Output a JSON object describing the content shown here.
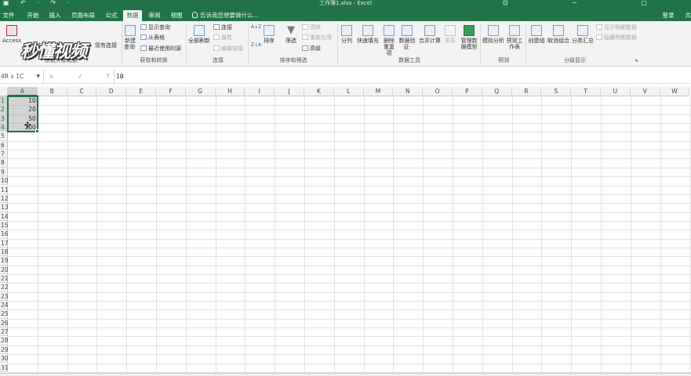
{
  "window": {
    "title": "工作簿1.xlsx - Excel",
    "quick_access": "▣ ↶ · ↷ ·",
    "controls": "⊡ ─ ▢"
  },
  "tabs": [
    "文件",
    "开始",
    "插入",
    "页面布局",
    "公式",
    "数据",
    "审阅",
    "视图"
  ],
  "active_tab": "数据",
  "tellme": "告诉我您想要做什么...",
  "account": {
    "login": "登录",
    "share": "共"
  },
  "ribbon": {
    "external": {
      "access": "Access",
      "web": "自网站",
      "text": "自文本",
      "other": "自其他来源",
      "existing": "现有连接",
      "group": "获取外部数据"
    },
    "transform": {
      "new_query": "新建查询·",
      "show_queries": "显示查询",
      "from_table": "从表格",
      "recent": "最近使用的源",
      "group": "获取和转换"
    },
    "connections": {
      "refresh_all": "全部刷新",
      "connections": "连接",
      "properties": "属性",
      "edit_links": "编辑链接",
      "group": "连接"
    },
    "sort_filter": {
      "sort": "排序",
      "filter": "筛选",
      "clear": "清除",
      "reapply": "重新应用",
      "advanced": "高级",
      "group": "排序和筛选"
    },
    "data_tools": {
      "split": "分列",
      "flash_fill": "快速填充",
      "remove_dup": "删除重复项",
      "validation": "数据验证·",
      "consolidate": "合并计算",
      "relationships": "关系",
      "data_model": "管理数据模型",
      "group": "数据工具"
    },
    "forecast": {
      "whatif": "模拟分析",
      "forecast_sheet": "预测工作表",
      "group": "预测"
    },
    "outline": {
      "group_btn": "创建组",
      "ungroup": "取消组合",
      "subtotal": "分类汇总",
      "show_detail": "显示明细数据",
      "hide_detail": "隐藏明细数据",
      "group": "分级显示"
    }
  },
  "watermark": "秒懂视频",
  "formula_bar": {
    "name_box": "4R x 1C",
    "fx_buttons": "× ✓ fx",
    "value": "10"
  },
  "columns": [
    "A",
    "B",
    "C",
    "D",
    "E",
    "F",
    "G",
    "H",
    "I",
    "J",
    "K",
    "L",
    "M",
    "N",
    "O",
    "P",
    "Q",
    "R",
    "S",
    "T",
    "U",
    "V",
    "W"
  ],
  "rows": [
    "1",
    "2",
    "3",
    "4",
    "5",
    "6",
    "7",
    "8",
    "9",
    "10",
    "11",
    "12",
    "13",
    "14",
    "15",
    "16",
    "17",
    "18",
    "19",
    "20",
    "21",
    "22",
    "23",
    "24",
    "25",
    "26",
    "27",
    "28",
    "29",
    "30",
    "31"
  ],
  "cells": {
    "A1": "10",
    "A2": "20",
    "A3": "50",
    "A4": "100"
  },
  "selection": {
    "range": "A1:A4",
    "color": "#217346"
  },
  "colors": {
    "accent": "#217346",
    "ribbon_bg": "#f3f3f3"
  }
}
